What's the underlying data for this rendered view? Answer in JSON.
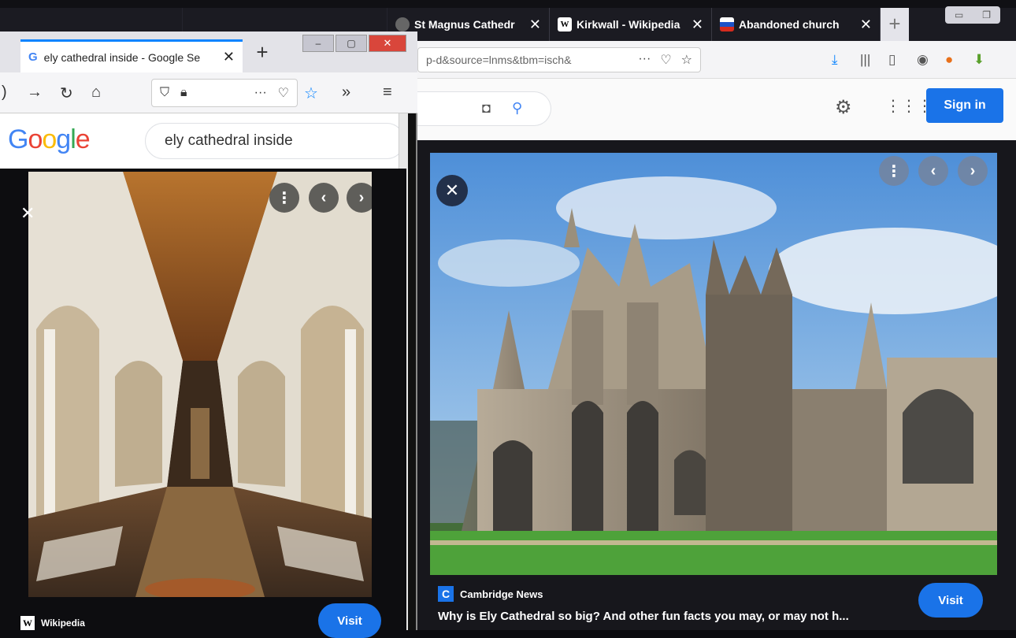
{
  "background_window": {
    "tabs": [
      {
        "label": "St Magnus Cathedr",
        "favicon": "globe-icon"
      },
      {
        "label": "Kirkwall - Wikipedia",
        "favicon": "W"
      },
      {
        "label": "Abandoned church",
        "favicon": "flag-icon"
      }
    ],
    "tab_close": "✕",
    "new_tab": "+",
    "url": "p-d&source=lnms&tbm=isch&",
    "url_more": "···",
    "sign_in": "Sign in",
    "viewer": {
      "source_letter": "C",
      "source": "Cambridge News",
      "caption": "Why is Ely Cathedral so big? And other fun facts you may, or may not h...",
      "visit": "Visit"
    }
  },
  "foreground_window": {
    "tab_title": "ely cathedral inside - Google Se",
    "tab_favicon": "G",
    "tab_close": "✕",
    "new_tab": "+",
    "url_more": "···",
    "overflow": "»",
    "logo": {
      "letters": [
        "G",
        "o",
        "o",
        "g",
        "l",
        "e"
      ],
      "colors": [
        "#4285f4",
        "#ea4335",
        "#fbbc05",
        "#4285f4",
        "#34a853",
        "#ea4335"
      ]
    },
    "search_value": "ely cathedral inside",
    "viewer": {
      "source_letter": "W",
      "source": "Wikipedia",
      "visit": "Visit"
    }
  }
}
